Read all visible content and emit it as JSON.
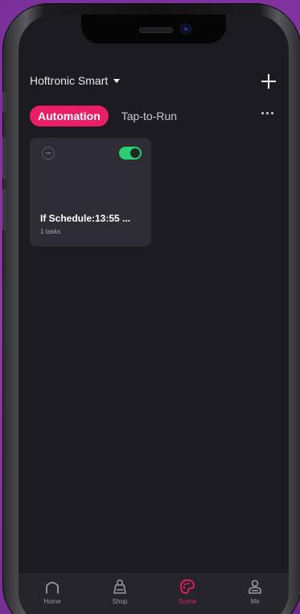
{
  "header": {
    "home_name": "Hoftronic Smart"
  },
  "tabs": [
    {
      "label": "Automation",
      "active": true
    },
    {
      "label": "Tap-to-Run",
      "active": false
    }
  ],
  "scenes": [
    {
      "title": "If Schedule:13:55 ...",
      "subtitle": "1 tasks",
      "enabled": true
    }
  ],
  "tabbar": [
    {
      "label": "Home",
      "icon": "home-icon",
      "active": false
    },
    {
      "label": "Shop",
      "icon": "shop-bag-icon",
      "active": false
    },
    {
      "label": "Scene",
      "icon": "scene-palette-icon",
      "active": true
    },
    {
      "label": "Me",
      "icon": "person-icon",
      "active": false
    }
  ],
  "colors": {
    "accent": "#e91e63",
    "toggle_on": "#2ecc71",
    "background": "#1c1b22",
    "card": "#2e2d35"
  }
}
